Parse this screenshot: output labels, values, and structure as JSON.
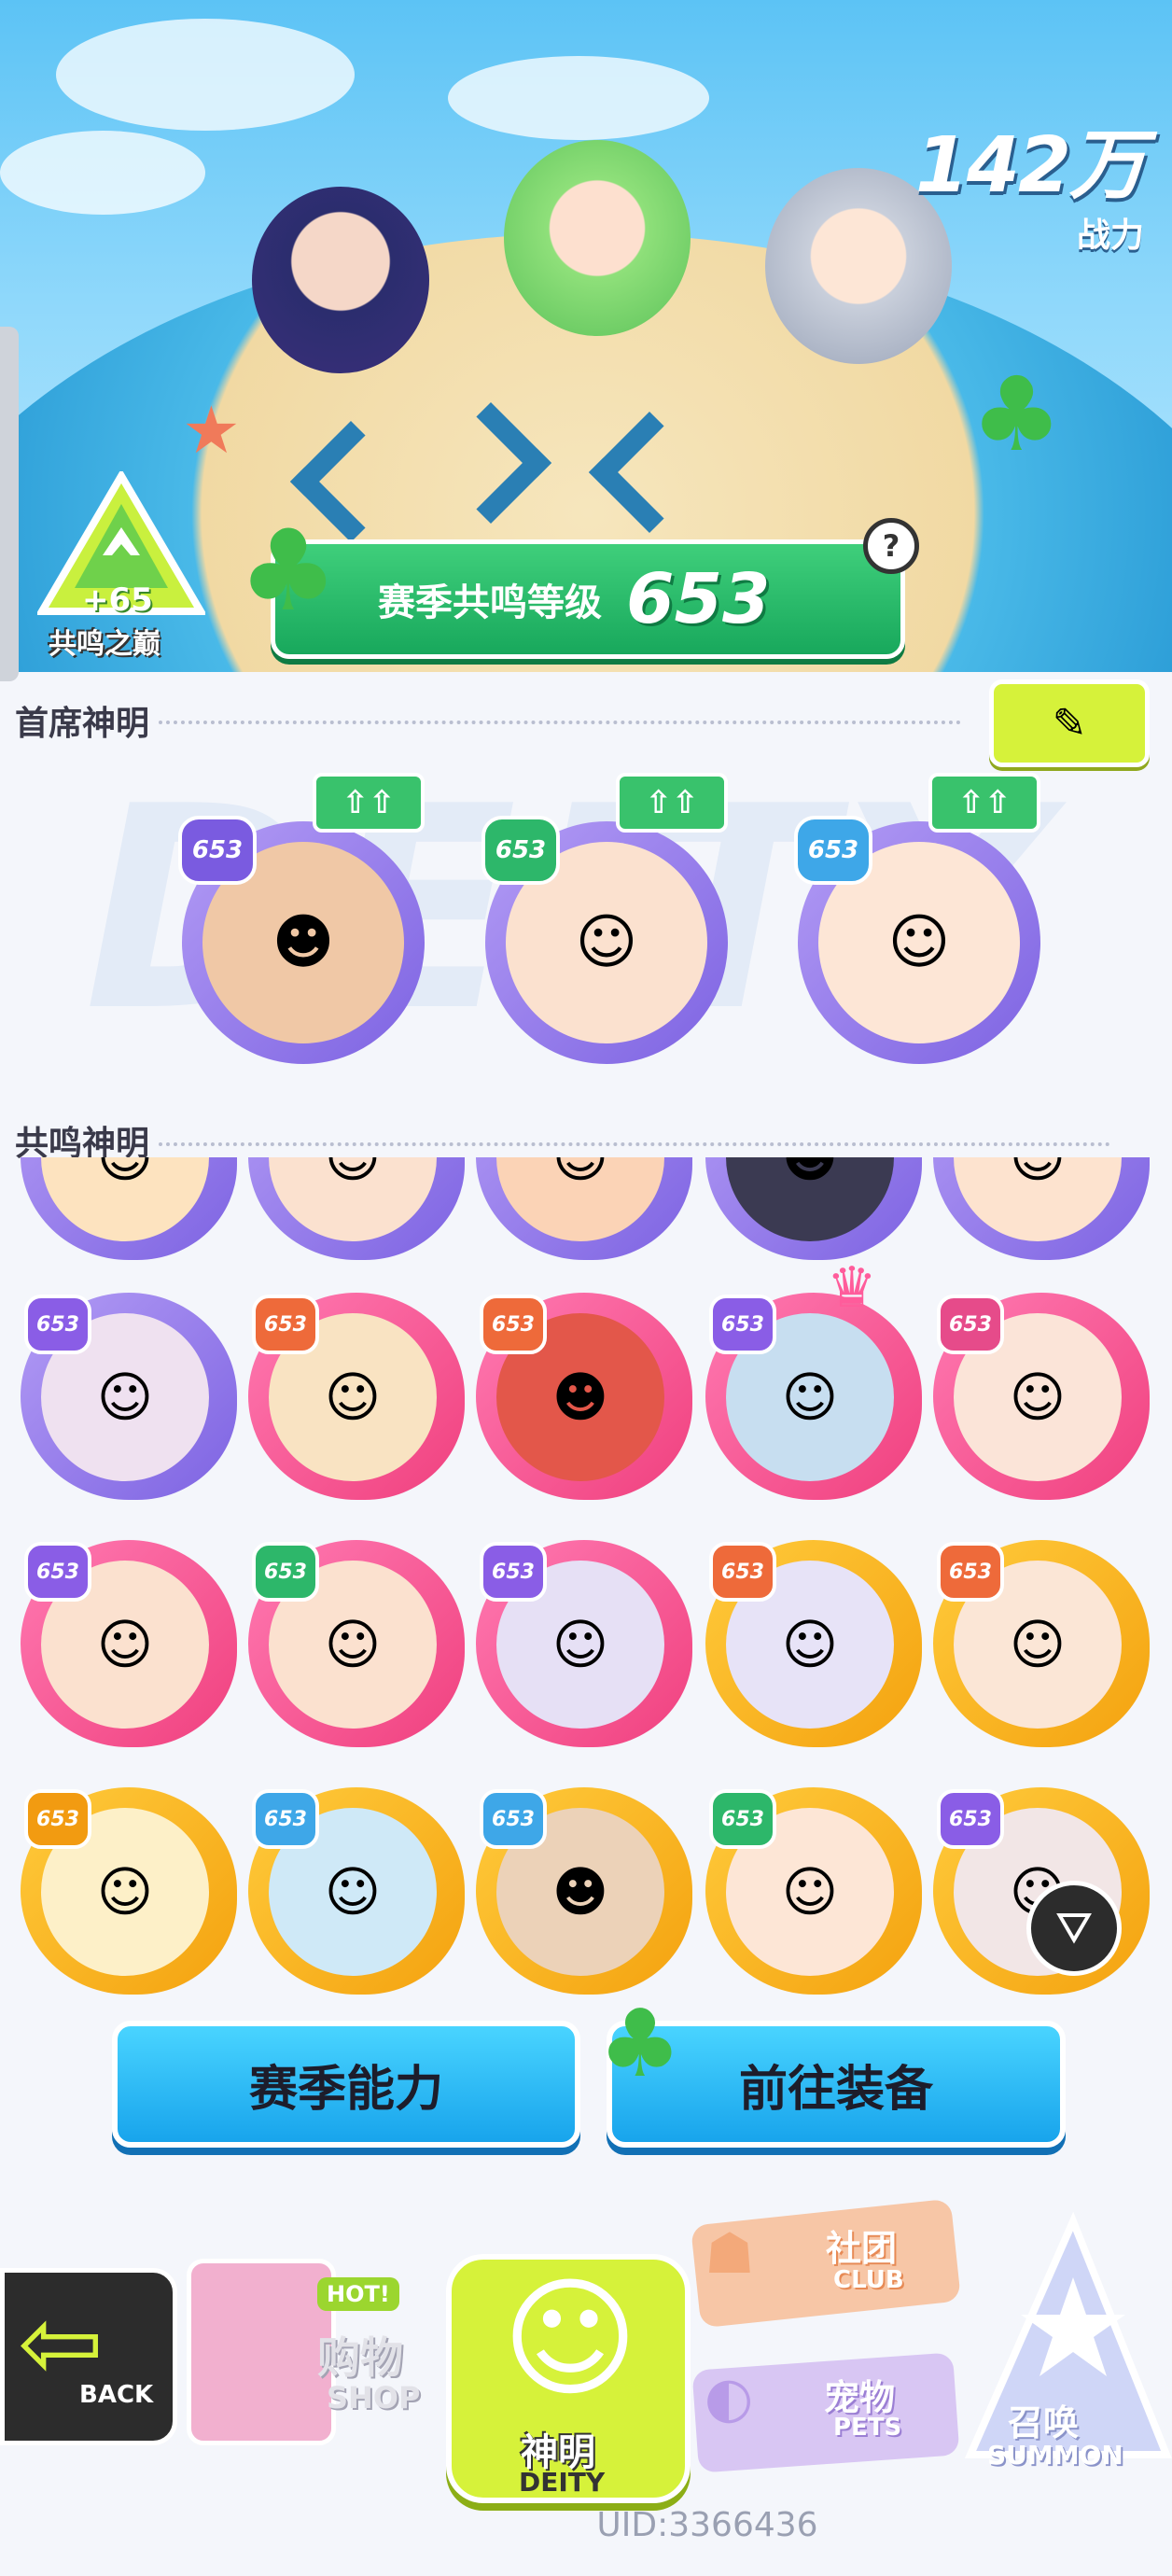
{
  "power": {
    "value": "142万",
    "label": "战力"
  },
  "resonance_peak": {
    "bonus": "+65",
    "label": "共鸣之巅"
  },
  "season": {
    "label": "赛季共鸣等级",
    "level": "653"
  },
  "sections": {
    "top_deities": "首席神明",
    "resonance_deities": "共鸣神明"
  },
  "watermark": "DEITY",
  "top_deities": [
    {
      "level": "653",
      "up": "⇧⇧",
      "color": "purple"
    },
    {
      "level": "653",
      "up": "⇧⇧",
      "color": "purple"
    },
    {
      "level": "653",
      "up": "⇧⇧",
      "color": "purple"
    }
  ],
  "resonance_rows": [
    [
      {
        "level": "653",
        "frame": "purple",
        "lvl": "p"
      },
      {
        "level": "653",
        "frame": "pink",
        "lvl": "o"
      },
      {
        "level": "653",
        "frame": "pink",
        "lvl": "o"
      },
      {
        "level": "653",
        "frame": "purple",
        "lvl": "p"
      },
      {
        "level": "653",
        "frame": "pink",
        "lvl": "pk"
      }
    ],
    [
      {
        "level": "653",
        "frame": "pink",
        "lvl": "pk"
      },
      {
        "level": "653",
        "frame": "pink",
        "lvl": "o"
      },
      {
        "level": "653",
        "frame": "pink",
        "lvl": "o"
      },
      {
        "level": "653",
        "frame": "pink",
        "lvl": "g"
      },
      {
        "level": "653",
        "frame": "pink",
        "lvl": "pk"
      }
    ],
    [
      {
        "level": "653",
        "frame": "gold",
        "lvl": "y"
      },
      {
        "level": "653",
        "frame": "gold",
        "lvl": "p"
      },
      {
        "level": "653",
        "frame": "gold",
        "lvl": "p"
      },
      {
        "level": "653",
        "frame": "gold",
        "lvl": "g"
      },
      {
        "level": "653",
        "frame": "gold",
        "lvl": "p"
      }
    ]
  ],
  "buttons": {
    "season_ability": "赛季能力",
    "go_equip": "前往装备"
  },
  "nav": {
    "back": "BACK",
    "shop_cn": "购物",
    "shop_en": "SHOP",
    "hot": "HOT!",
    "deity_cn": "神明",
    "deity_en": "DEITY",
    "club_cn": "社团",
    "club_en": "CLUB",
    "pets_cn": "宠物",
    "pets_en": "PETS",
    "summon_cn": "召唤",
    "summon_en": "SUMMON"
  },
  "uid": "UID:3366436"
}
